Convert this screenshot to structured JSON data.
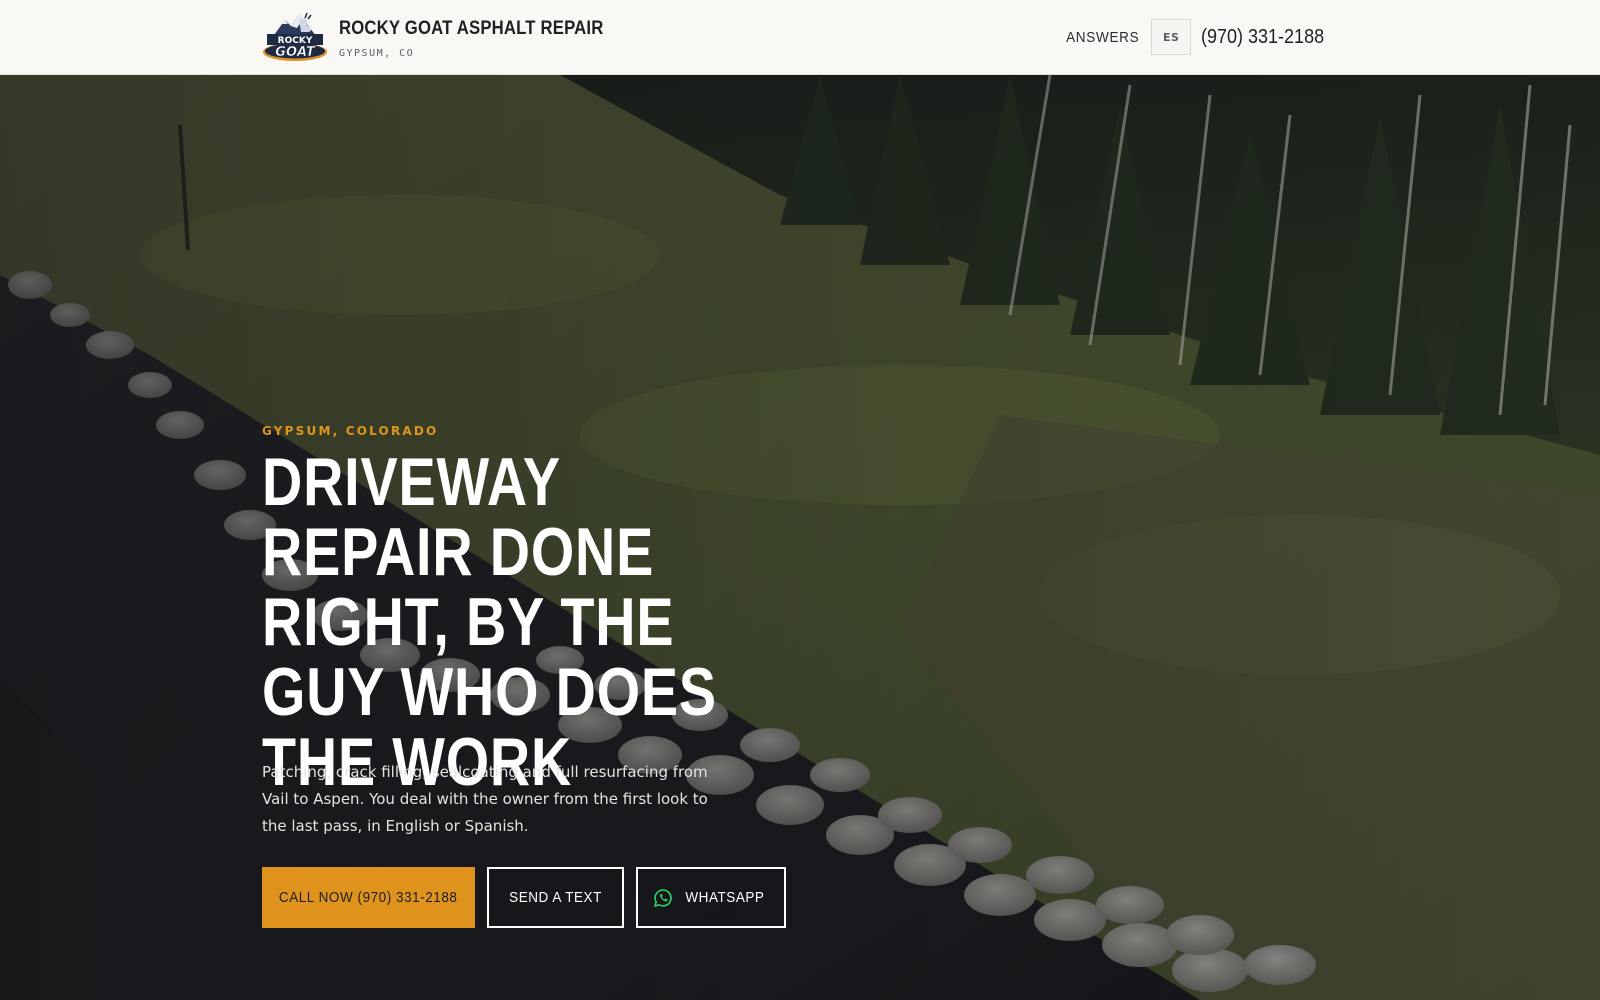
{
  "header": {
    "brand_name": "ROCKY GOAT ASPHALT REPAIR",
    "brand_location": "GYPSUM, CO",
    "logo_text_top": "ROCKY",
    "logo_text_bottom": "GOAT",
    "nav_answers": "ANSWERS",
    "lang_toggle": "ES",
    "phone": "(970) 331-2188"
  },
  "hero": {
    "eyebrow": "GYPSUM, COLORADO",
    "headline": "DRIVEWAY REPAIR DONE RIGHT, BY THE GUY WHO DOES THE WORK",
    "lead": "Patching, crack filling, sealcoating and full resurfacing from Vail to Aspen. You deal with the owner from the first look to the last pass, in English or Spanish.",
    "ctas": {
      "call": "CALL NOW (970) 331-2188",
      "text": "SEND A TEXT",
      "whatsapp": "WHATSAPP"
    }
  },
  "colors": {
    "accent": "#df931c",
    "header_bg": "#f9f8f5",
    "whatsapp": "#25d366"
  },
  "icons": {
    "whatsapp": "whatsapp-icon",
    "logo": "mountain-goat-logo"
  }
}
